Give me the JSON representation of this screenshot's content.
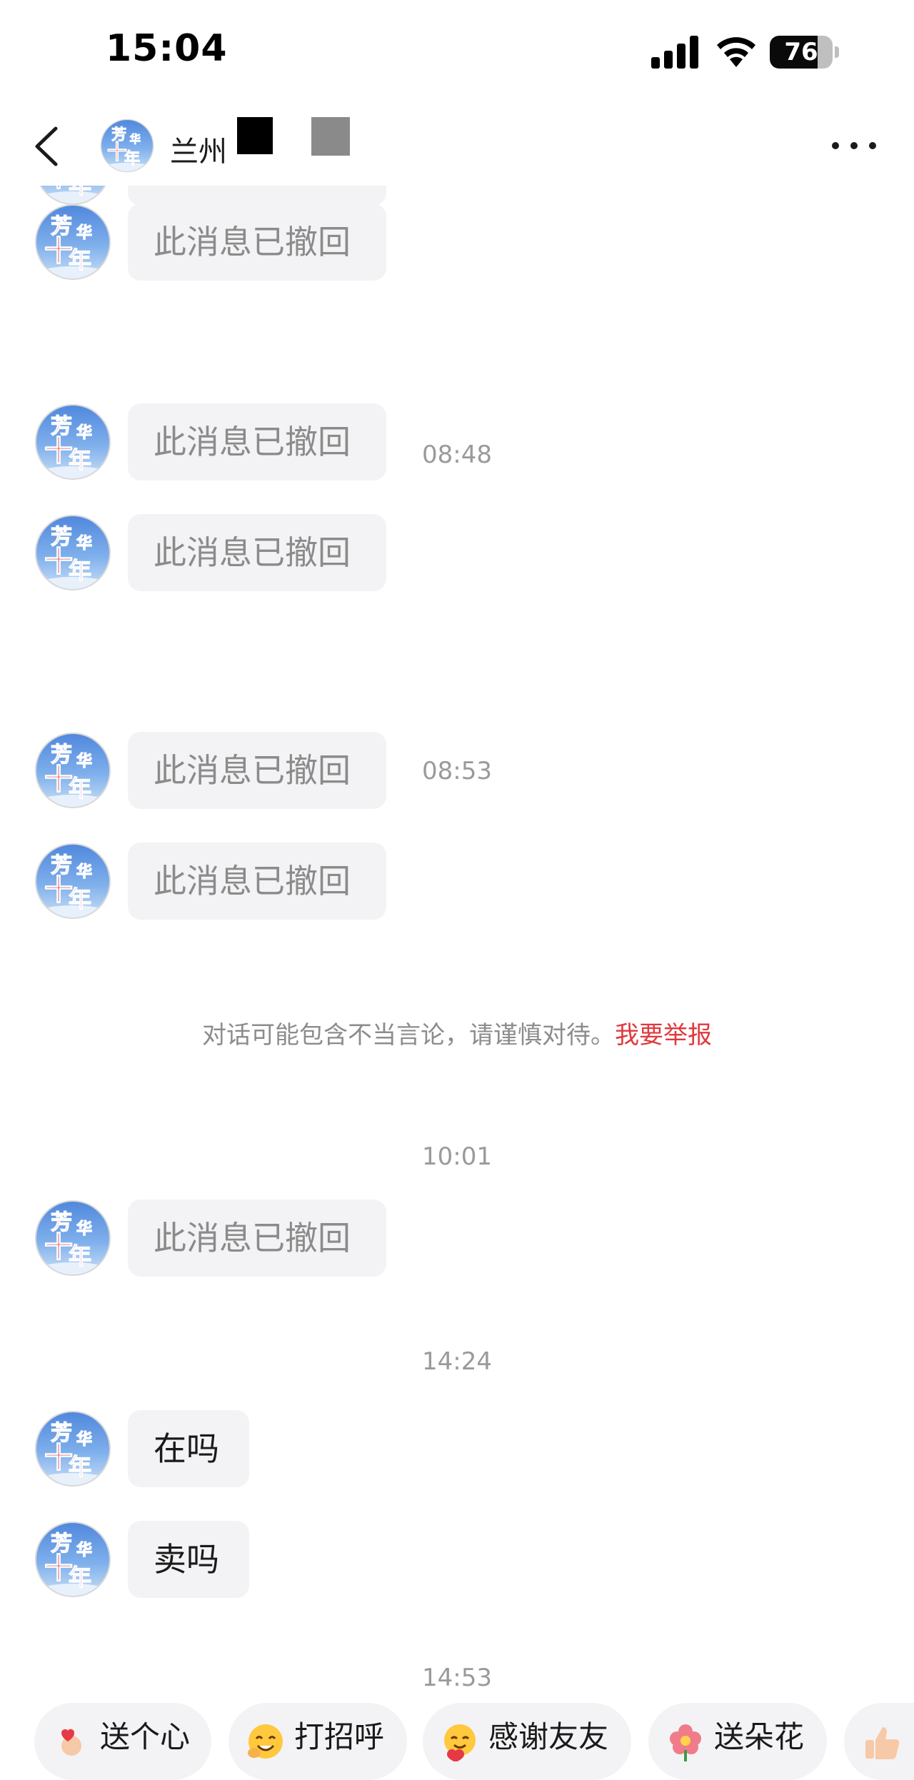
{
  "status_bar": {
    "time": "15:04",
    "battery": "76",
    "battery_level": 0.76,
    "icons": [
      "signal-icon",
      "wifi-icon",
      "battery-icon"
    ]
  },
  "header": {
    "name": "兰州",
    "avatar_text": [
      "芳",
      "华",
      "十",
      "年"
    ],
    "icons": [
      "back-arrow-icon",
      "more-dots-icon"
    ]
  },
  "chat": {
    "messages": [
      {
        "type": "recalled",
        "text": "此消息已撤回"
      },
      {
        "type": "recalled",
        "text": "此消息已撤回"
      },
      {
        "type": "time",
        "text": "08:48"
      },
      {
        "type": "recalled",
        "text": "此消息已撤回"
      },
      {
        "type": "recalled",
        "text": "此消息已撤回"
      },
      {
        "type": "time",
        "text": "08:53"
      },
      {
        "type": "recalled",
        "text": "此消息已撤回"
      },
      {
        "type": "recalled",
        "text": "此消息已撤回"
      },
      {
        "type": "warning",
        "text": "对话可能包含不当言论，请谨慎对待。",
        "link": "我要举报"
      },
      {
        "type": "time",
        "text": "10:01"
      },
      {
        "type": "recalled",
        "text": "此消息已撤回"
      },
      {
        "type": "time",
        "text": "14:24"
      },
      {
        "type": "text",
        "text": "在吗"
      },
      {
        "type": "text",
        "text": "卖吗"
      },
      {
        "type": "time",
        "text": "14:53"
      }
    ]
  },
  "quick_replies": [
    {
      "label": "送个心",
      "icon": "heart-hand-icon"
    },
    {
      "label": "打招呼",
      "icon": "greeting-face-icon"
    },
    {
      "label": "感谢友友",
      "icon": "hug-face-icon"
    },
    {
      "label": "送朵花",
      "icon": "flower-icon"
    },
    {
      "label": "",
      "icon": "thumbs-up-icon"
    }
  ],
  "colors": {
    "bubble_bg": "#f3f3f5",
    "recalled_text": "#8b8b8b",
    "report_link": "#e0383e",
    "avatar_sky": "#5f93e0"
  }
}
